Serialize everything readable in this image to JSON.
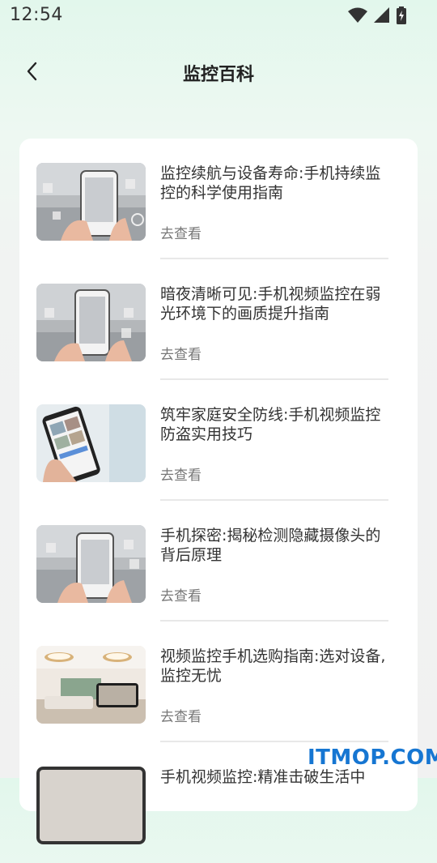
{
  "status_bar": {
    "time": "12:54",
    "icons": [
      "wifi-icon",
      "signal-icon",
      "battery-charging-icon"
    ]
  },
  "header": {
    "title": "监控百科",
    "back_icon": "chevron-left-icon"
  },
  "articles": [
    {
      "title": "监控续航与设备寿命:手机持续监控的科学使用指南",
      "link": "去查看",
      "thumbnail": "hands-holding-phone-smart-home"
    },
    {
      "title": "暗夜清晰可见:手机视频监控在弱光环境下的画质提升指南",
      "link": "去查看",
      "thumbnail": "hands-holding-phone-smart-home"
    },
    {
      "title": "筑牢家庭安全防线:手机视频监控防盗实用技巧",
      "link": "去查看",
      "thumbnail": "hand-holding-phone-video-grid"
    },
    {
      "title": "手机探密:揭秘检测隐藏摄像头的背后原理",
      "link": "去查看",
      "thumbnail": "hands-holding-phone-smart-home"
    },
    {
      "title": "视频监控手机选购指南:选对设备,监控无忧",
      "link": "去查看",
      "thumbnail": "living-room-with-phone"
    },
    {
      "title": "手机视频监控:精准击破生活中",
      "link": "",
      "thumbnail": "phone-edge"
    }
  ],
  "watermark": "ITMOP.COM",
  "colors": {
    "accent_watermark": "#1676d2",
    "background_top": "#e2f7ec",
    "card": "#ffffff"
  }
}
